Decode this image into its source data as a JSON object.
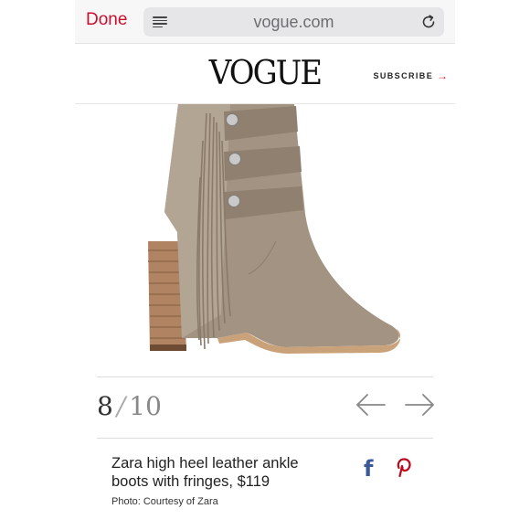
{
  "browser": {
    "done_label": "Done",
    "url": "vogue.com"
  },
  "header": {
    "logo": "VOGUE",
    "subscribe_label": "SUBSCRIBE",
    "subscribe_arrow": "→"
  },
  "gallery": {
    "current": "8",
    "separator": "/",
    "total": "10"
  },
  "caption": {
    "text": "Zara high heel leather ankle boots with fringes, $119",
    "credit": "Photo: Courtesy of Zara"
  },
  "share": {
    "facebook_glyph": "f"
  },
  "colors": {
    "accent": "#c8102e",
    "facebook": "#3b5998",
    "pinterest": "#bd081c",
    "boot_suede": "#9c8d7d"
  }
}
